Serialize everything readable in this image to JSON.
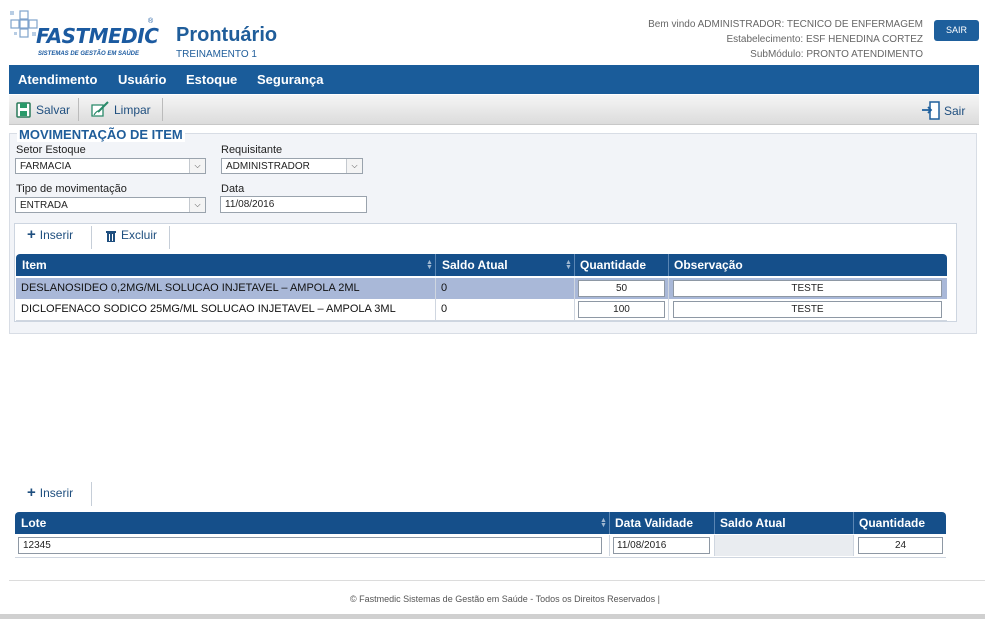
{
  "brand": {
    "logo_text": "FASTMEDIC",
    "logo_tagline": "SISTEMAS DE GESTÃO EM SAÚDE",
    "app_title": "Prontuário",
    "app_subtitle": "TREINAMENTO 1"
  },
  "header": {
    "welcome": "Bem vindo ADMINISTRADOR: TECNICO DE ENFERMAGEM",
    "establishment": "Estabelecimento: ESF HENEDINA CORTEZ",
    "submodule": "SubMódulo: PRONTO ATENDIMENTO",
    "logout_label": "SAIR"
  },
  "nav": {
    "items": [
      "Atendimento",
      "Usuário",
      "Estoque",
      "Segurança"
    ]
  },
  "toolbar": {
    "save_label": "Salvar",
    "clear_label": "Limpar",
    "exit_label": "Sair"
  },
  "form": {
    "title": "MOVIMENTAÇÃO DE ITEM",
    "setor_label": "Setor Estoque",
    "setor_value": "FARMACIA",
    "requisitante_label": "Requisitante",
    "requisitante_value": "ADMINISTRADOR",
    "tipo_label": "Tipo de movimentação",
    "tipo_value": "ENTRADA",
    "data_label": "Data",
    "data_value": "11/08/2016"
  },
  "items_grid": {
    "insert_label": "Inserir",
    "delete_label": "Excluir",
    "columns": [
      "Item",
      "Saldo Atual",
      "Quantidade",
      "Observação"
    ],
    "rows": [
      {
        "item": "DESLANOSIDEO 0,2MG/ML SOLUCAO INJETAVEL – AMPOLA 2ML",
        "saldo": "0",
        "quantidade": "50",
        "observacao": "TESTE"
      },
      {
        "item": "DICLOFENACO SODICO 25MG/ML SOLUCAO INJETAVEL – AMPOLA 3ML",
        "saldo": "0",
        "quantidade": "100",
        "observacao": "TESTE"
      }
    ]
  },
  "lote_grid": {
    "insert_label": "Inserir",
    "columns": [
      "Lote",
      "Data Validade",
      "Saldo Atual",
      "Quantidade"
    ],
    "rows": [
      {
        "lote": "12345",
        "validade": "11/08/2016",
        "saldo": "",
        "quantidade": "24"
      }
    ]
  },
  "footer": {
    "text": "© Fastmedic Sistemas de Gestão em Saúde - Todos os Direitos Reservados |"
  },
  "colors": {
    "primary": "#1a5c9a",
    "selected_row": "#a9b8d8"
  }
}
